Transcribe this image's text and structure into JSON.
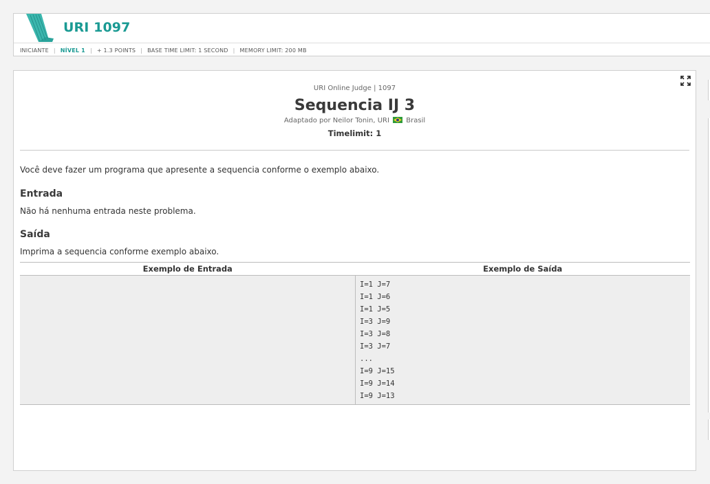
{
  "header": {
    "title": "URI 1097",
    "meta": {
      "category": "INICIANTE",
      "level": "NÍVEL 1",
      "points": "+ 1.3 POINTS",
      "time_limit": "BASE TIME LIMIT: 1 SECOND",
      "memory_limit": "MEMORY LIMIT: 200 MB"
    }
  },
  "problem": {
    "judge_line": "URI Online Judge | 1097",
    "name": "Sequencia IJ 3",
    "author_prefix": "Adaptado por Neilor Tonin, URI",
    "country": "Brasil",
    "timelimit": "Timelimit: 1",
    "description": "Você deve fazer um programa que apresente a sequencia conforme o exemplo abaixo.",
    "input_heading": "Entrada",
    "input_text": "Não há nenhuma entrada neste problema.",
    "output_heading": "Saída",
    "output_text": "Imprima a sequencia conforme exemplo abaixo."
  },
  "samples": {
    "input_header": "Exemplo de Entrada",
    "output_header": "Exemplo de Saída",
    "input": "",
    "output_lines": [
      "I=1 J=7",
      "I=1 J=6",
      "I=1 J=5",
      "I=3 J=9",
      "I=3 J=8",
      "I=3 J=7",
      "...",
      "I=9 J=15",
      "I=9 J=14",
      "I=9 J=13"
    ]
  },
  "colors": {
    "accent": "#1a9a93"
  },
  "icons": {
    "expand": "expand-icon",
    "flag": "brazil-flag-icon",
    "logo": "uri-logo-icon"
  }
}
